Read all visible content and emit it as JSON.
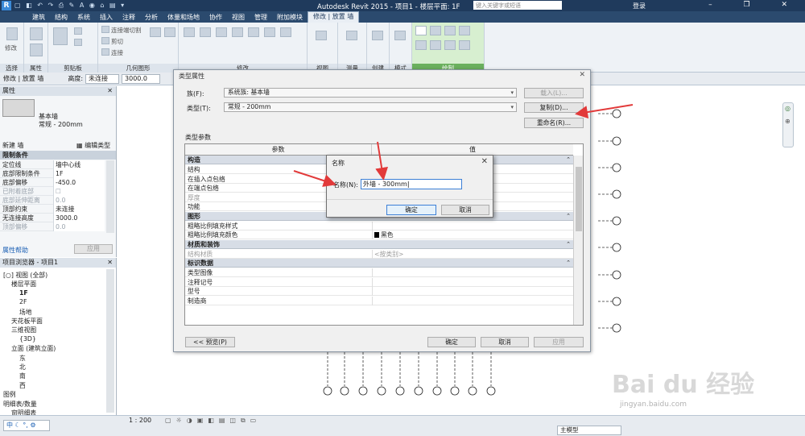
{
  "app": {
    "title": "Autodesk Revit 2015 -    项目1 - 楼层平面: 1F",
    "search_placeholder": "键入关键字或短语",
    "login": "登录",
    "appbtn": "R"
  },
  "tabs": [
    "建筑",
    "结构",
    "系统",
    "插入",
    "注释",
    "分析",
    "体量和场地",
    "协作",
    "视图",
    "管理",
    "附加模块",
    "修改 | 放置 墙"
  ],
  "ribbon": {
    "panels": [
      "选择",
      "属性",
      "剪贴板",
      "几何图形",
      "修改",
      "视图",
      "测量",
      "创建",
      "模式",
      "绘制"
    ],
    "tools": {
      "modify": "修改",
      "connect": "连接端切割",
      "cut": "剪切",
      "join": "连接"
    }
  },
  "optbar": {
    "context": "修改 | 放置 墙",
    "height_label": "高度:",
    "height_value": "未连接",
    "height_num": "3000.0"
  },
  "properties": {
    "header": "属性",
    "type_name": "基本墙",
    "type_sub": "常规 - 200mm",
    "new_label": "新建 墙",
    "edit_type": "编辑类型",
    "section": "限制条件",
    "rows": [
      {
        "k": "定位线",
        "v": "墙中心线"
      },
      {
        "k": "底部限制条件",
        "v": "1F"
      },
      {
        "k": "底部偏移",
        "v": "-450.0"
      },
      {
        "k": "已附着底部",
        "v": ""
      },
      {
        "k": "底部延伸距离",
        "v": "0.0"
      },
      {
        "k": "顶部约束",
        "v": "未连接"
      },
      {
        "k": "无连接高度",
        "v": "3000.0"
      },
      {
        "k": "顶部偏移",
        "v": "0.0"
      }
    ],
    "help": "属性帮助",
    "apply": "应用"
  },
  "browser": {
    "header": "项目浏览器 - 项目1",
    "items": [
      {
        "t": "[○] 视图 (全部)",
        "lvl": 0
      },
      {
        "t": "楼层平面",
        "lvl": 1
      },
      {
        "t": "1F",
        "lvl": 2
      },
      {
        "t": "2F",
        "lvl": 2
      },
      {
        "t": "场地",
        "lvl": 2
      },
      {
        "t": "天花板平面",
        "lvl": 1
      },
      {
        "t": "三维视图",
        "lvl": 1
      },
      {
        "t": "{3D}",
        "lvl": 2
      },
      {
        "t": "立面 (建筑立面)",
        "lvl": 1
      },
      {
        "t": "东",
        "lvl": 2
      },
      {
        "t": "北",
        "lvl": 2
      },
      {
        "t": "南",
        "lvl": 2
      },
      {
        "t": "西",
        "lvl": 2
      },
      {
        "t": "图例",
        "lvl": 0
      },
      {
        "t": "明细表/数量",
        "lvl": 0
      },
      {
        "t": "窗明细表",
        "lvl": 1
      }
    ]
  },
  "type_dialog": {
    "title": "类型属性",
    "family_label": "族(F):",
    "family_value": "系统族: 基本墙",
    "type_label": "类型(T):",
    "type_value": "常规 - 200mm",
    "load_btn": "载入(L)...",
    "duplicate_btn": "复制(D)...",
    "rename_btn": "重命名(R)...",
    "params_label": "类型参数",
    "col_param": "参数",
    "col_value": "值",
    "groups": [
      {
        "name": "构造",
        "rows": [
          {
            "k": "结构",
            "v": ""
          },
          {
            "k": "在插入点包络",
            "v": ""
          },
          {
            "k": "在端点包络",
            "v": ""
          },
          {
            "k": "厚度",
            "v": "",
            "dim": true
          },
          {
            "k": "功能",
            "v": ""
          }
        ]
      },
      {
        "name": "图形",
        "rows": [
          {
            "k": "粗略比例填充样式",
            "v": ""
          },
          {
            "k": "粗略比例填充颜色",
            "v": "黑色"
          }
        ]
      },
      {
        "name": "材质和装饰",
        "rows": [
          {
            "k": "结构材质",
            "v": "<按类别>",
            "dim": true
          }
        ]
      },
      {
        "name": "标识数据",
        "rows": [
          {
            "k": "类型图像",
            "v": ""
          },
          {
            "k": "注释记号",
            "v": ""
          },
          {
            "k": "型号",
            "v": ""
          },
          {
            "k": "制造商",
            "v": ""
          }
        ]
      }
    ],
    "preview_btn": "<< 预览(P)",
    "ok_btn": "确定",
    "cancel_btn": "取消",
    "apply_btn": "应用"
  },
  "name_dialog": {
    "title": "名称",
    "label": "名称(N):",
    "value": "外墙 - 300mm",
    "ok_btn": "确定",
    "cancel_btn": "取消"
  },
  "status": {
    "scale": "1 : 200",
    "model": "主模型",
    "ime": "中"
  },
  "watermark": {
    "brand": "Bai du 经验",
    "url": "jingyan.baidu.com"
  },
  "colors": {
    "accent": "#1f3a5c",
    "arrow": "#e23a3a",
    "draw_panel": "#6ab05d"
  }
}
